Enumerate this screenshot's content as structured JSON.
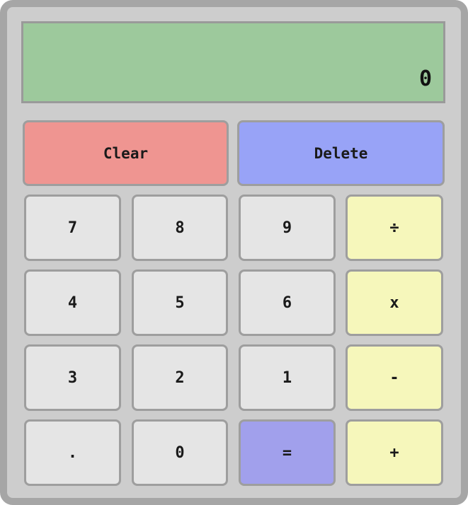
{
  "display": {
    "value": "0"
  },
  "buttons": {
    "clear": "Clear",
    "delete": "Delete",
    "n7": "7",
    "n8": "8",
    "n9": "9",
    "divide": "÷",
    "n4": "4",
    "n5": "5",
    "n6": "6",
    "multiply": "x",
    "n3": "3",
    "n2": "2",
    "n1": "1",
    "subtract": "-",
    "decimal": ".",
    "n0": "0",
    "equals": "=",
    "add": "+"
  },
  "colors": {
    "display_bg": "#9dc99c",
    "clear_bg": "#ef9591",
    "delete_bg": "#98a3f7",
    "operator_bg": "#f6f7bb",
    "equals_bg": "#a1a0ec",
    "digit_bg": "#e5e5e5",
    "body_bg": "#cdcdcd"
  }
}
